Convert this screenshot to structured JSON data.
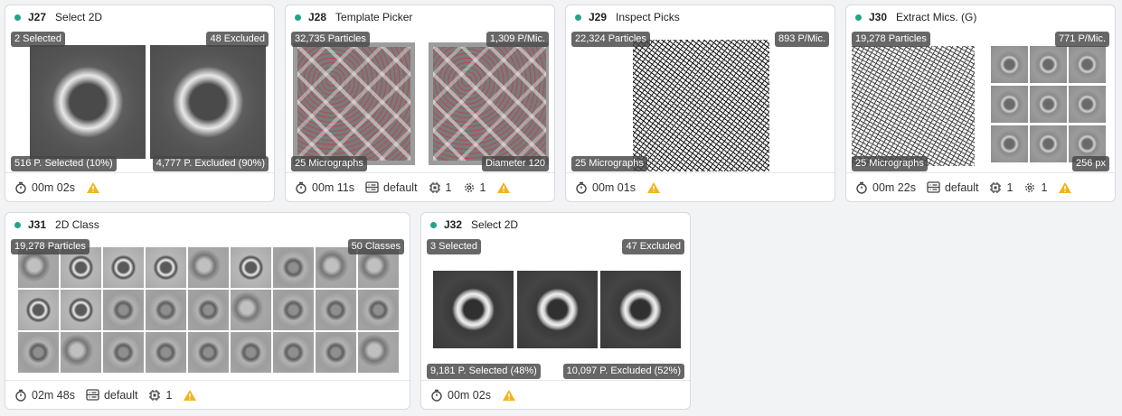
{
  "colors": {
    "status_dot": "#21a585",
    "warning": "#f0b41e",
    "icon": "#444444"
  },
  "cards": [
    {
      "id": "J27",
      "title": "Select 2D",
      "badges": {
        "tl": "2 Selected",
        "tr": "48 Excluded",
        "bl": "516 P. Selected (10%)",
        "br": "4,777 P. Excluded (90%)"
      },
      "footer": {
        "time": "00m 02s"
      }
    },
    {
      "id": "J28",
      "title": "Template Picker",
      "badges": {
        "tl": "32,735 Particles",
        "tr": "1,309 P/Mic.",
        "bl": "25 Micrographs",
        "br": "Diameter 120"
      },
      "footer": {
        "time": "00m 11s",
        "lane": "default",
        "gpus": "1",
        "threads": "1"
      }
    },
    {
      "id": "J29",
      "title": "Inspect Picks",
      "badges": {
        "tl": "22,324 Particles",
        "tr": "893 P/Mic.",
        "bl": "25 Micrographs"
      },
      "footer": {
        "time": "00m 01s"
      }
    },
    {
      "id": "J30",
      "title": "Extract Mics. (G)",
      "badges": {
        "tl": "19,278 Particles",
        "tr": "771 P/Mic.",
        "bl": "25 Micrographs",
        "br": "256 px"
      },
      "footer": {
        "time": "00m 22s",
        "lane": "default",
        "gpus": "1",
        "threads": "1"
      }
    },
    {
      "id": "J31",
      "title": "2D Class",
      "badges": {
        "tl": "19,278 Particles",
        "tr": "50 Classes"
      },
      "footer": {
        "time": "02m 48s",
        "lane": "default",
        "gpus": "1"
      }
    },
    {
      "id": "J32",
      "title": "Select 2D",
      "badges": {
        "tl": "3 Selected",
        "tr": "47 Excluded",
        "bl": "9,181 P. Selected (48%)",
        "br": "10,097 P. Excluded (52%)"
      },
      "footer": {
        "time": "00m 02s"
      }
    }
  ]
}
